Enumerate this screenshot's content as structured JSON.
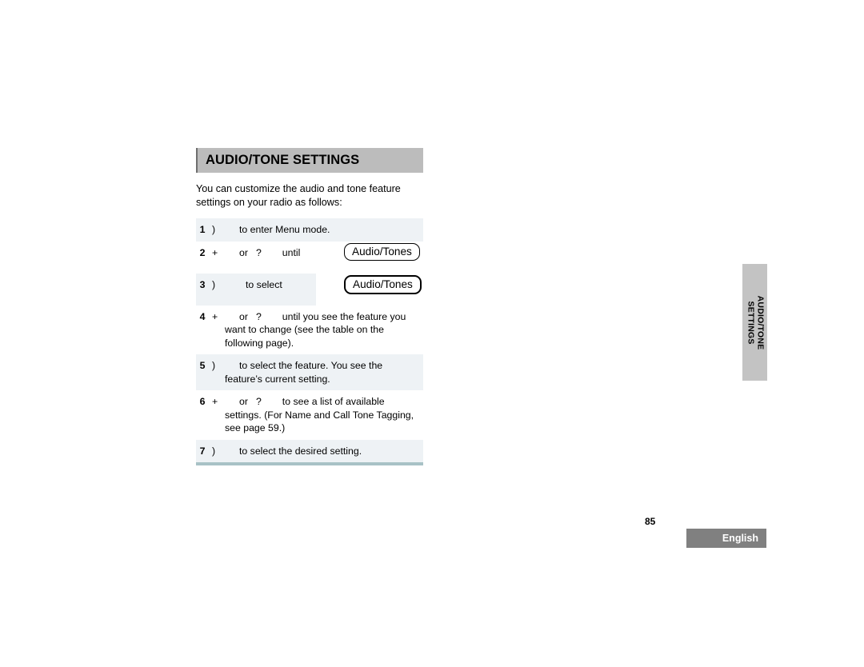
{
  "section": {
    "title": "AUDIO/TONE SETTINGS",
    "intro": "You can customize the audio and tone feature settings on your radio as follows:"
  },
  "steps": [
    {
      "number": "1",
      "key": ")",
      "text": "to enter Menu mode.",
      "callout": null,
      "shaded": true
    },
    {
      "number": "2",
      "key": "+",
      "text_a": "or",
      "key_b": "?",
      "text_b": "until",
      "callout": "Audio/Tones",
      "callout_weight": "normal",
      "shaded": false
    },
    {
      "number": "3",
      "key": ")",
      "text": "to select",
      "callout": "Audio/Tones",
      "callout_weight": "thick",
      "shaded": true
    },
    {
      "number": "4",
      "key": "+",
      "text_a": "or",
      "key_b": "?",
      "text_b": "until you see the feature you want to change (see the table on the following page).",
      "callout": null,
      "shaded": false
    },
    {
      "number": "5",
      "key": ")",
      "text": "to select the feature. You see the feature’s current setting.",
      "callout": null,
      "shaded": true
    },
    {
      "number": "6",
      "key": "+",
      "text_a": "or",
      "key_b": "?",
      "text_b": "to see a list of available settings. (For Name and Call Tone Tagging, see page 59.)",
      "callout": null,
      "shaded": false
    },
    {
      "number": "7",
      "key": ")",
      "text": "to select the desired setting.",
      "callout": null,
      "shaded": true
    }
  ],
  "side_tab": {
    "label": "AUDIO/TONE SETTINGS"
  },
  "footer": {
    "page_number": "85",
    "language": "English"
  },
  "colors": {
    "header_bar": "#bcbcbc",
    "header_edge": "#6f6f6f",
    "row_shade": "#eef2f5",
    "bottom_rule": "#a8c2c6",
    "side_tab": "#c3c3c3",
    "language_badge": "#808080"
  }
}
